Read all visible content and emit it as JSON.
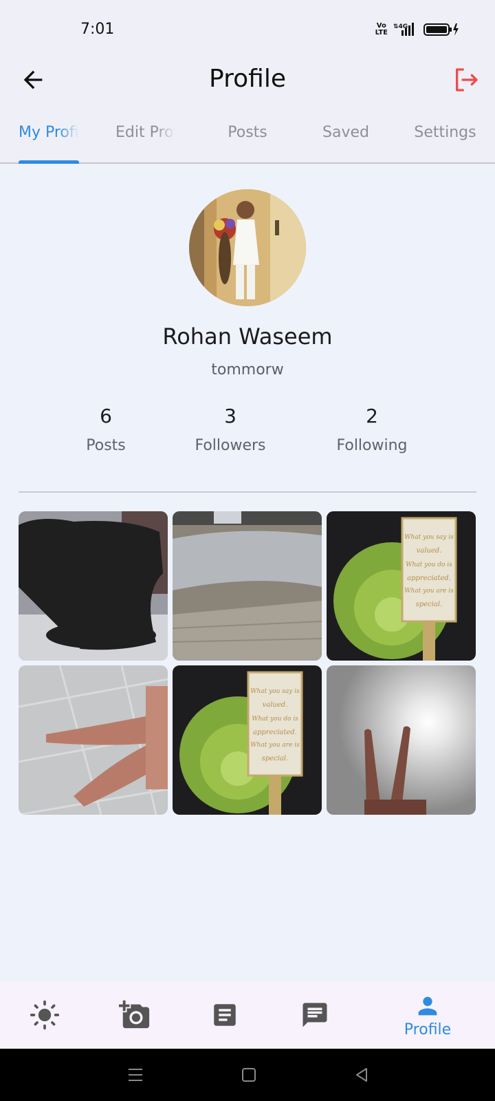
{
  "status_bar": {
    "time": "7:01",
    "network": "4G",
    "volte": "Vo LTE"
  },
  "app_bar": {
    "title": "Profile"
  },
  "tabs": [
    {
      "label": "My Profile",
      "active": true
    },
    {
      "label": "Edit Profile",
      "active": false
    },
    {
      "label": "Posts",
      "active": false
    },
    {
      "label": "Saved",
      "active": false
    },
    {
      "label": "Settings",
      "active": false
    }
  ],
  "profile": {
    "name": "Rohan Waseem",
    "username": "tommorw",
    "stats": [
      {
        "count": "6",
        "label": "Posts"
      },
      {
        "count": "3",
        "label": "Followers"
      },
      {
        "count": "2",
        "label": "Following"
      }
    ]
  },
  "bottom_nav": {
    "items": [
      {
        "icon": "brightness-icon"
      },
      {
        "icon": "add-photo-icon"
      },
      {
        "icon": "article-icon"
      },
      {
        "icon": "chat-icon"
      },
      {
        "icon": "person-icon",
        "label": "Profile",
        "active": true
      }
    ]
  },
  "colors": {
    "accent": "#2f8be0",
    "logout": "#f04b4b",
    "background": "#eef2fb"
  }
}
